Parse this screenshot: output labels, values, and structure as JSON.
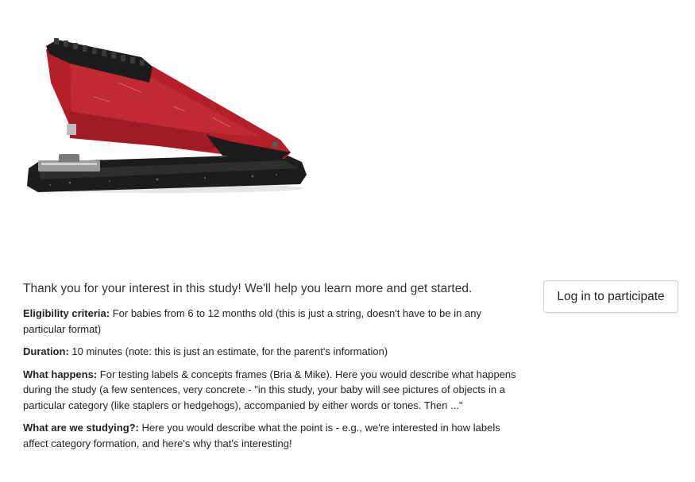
{
  "intro_text": "Thank you for your interest in this study! We'll help you learn more and get started.",
  "login_button_label": "Log in to participate",
  "sections": {
    "eligibility": {
      "label": "Eligibility criteria:",
      "text": "For babies from 6 to 12 months old (this is just a string, doesn't have to be in any particular format)"
    },
    "duration": {
      "label": "Duration:",
      "text": "10 minutes (note: this is just an estimate, for the parent's information)"
    },
    "what_happens": {
      "label": "What happens:",
      "text": "For testing labels & concepts frames (Bria & Mike). Here you would describe what happens during the study (a few sentences, very concrete - \"in this study, your baby will see pictures of objects in a particular category (like staplers or hedgehogs), accompanied by either words or tones. Then ...\""
    },
    "what_studying": {
      "label": "What are we studying?:",
      "text": "Here you would describe what the point is - e.g., we're interested in how labels affect category formation, and here's why that's interesting!"
    }
  },
  "colors": {
    "stapler_red": "#b3202a",
    "stapler_black": "#1c1c1c",
    "button_border": "#cfcfcf"
  }
}
